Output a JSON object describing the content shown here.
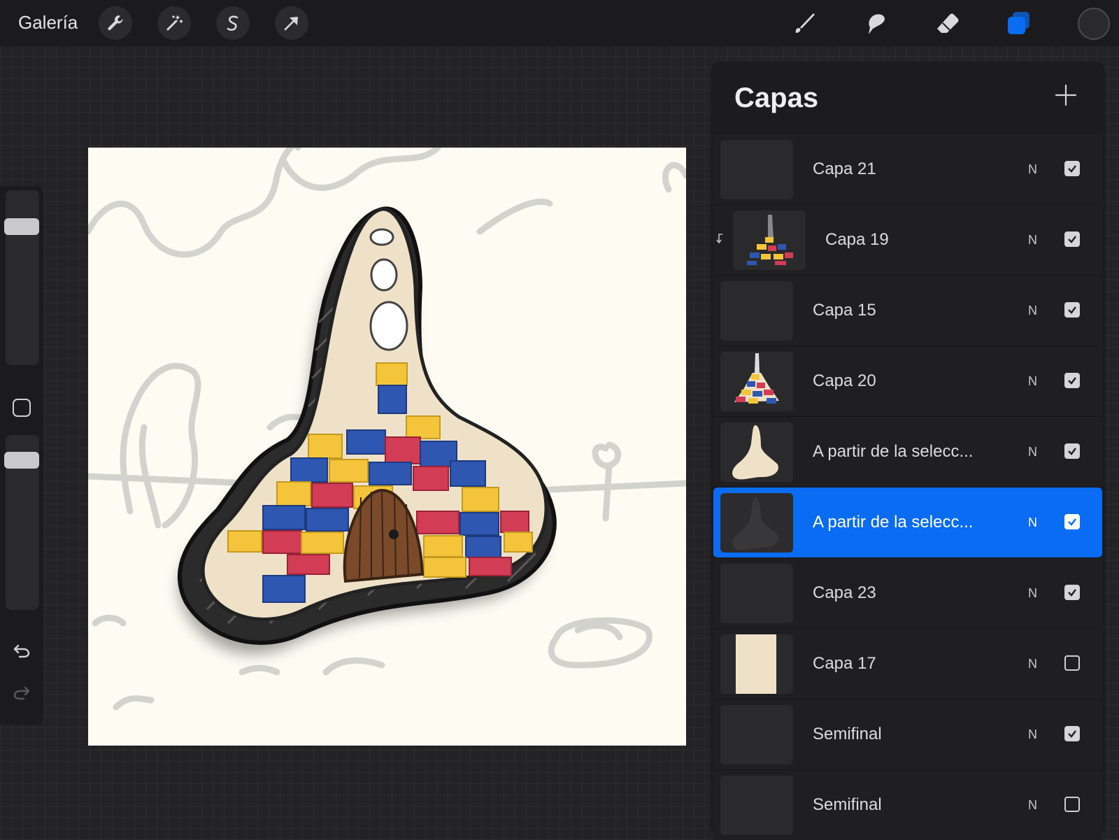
{
  "toolbar": {
    "gallery_label": "Galería",
    "left_tools": [
      {
        "name": "actions",
        "icon": "wrench-icon"
      },
      {
        "name": "adjustments",
        "icon": "magic-wand-icon"
      },
      {
        "name": "selection",
        "icon": "selection-s-icon"
      },
      {
        "name": "transform",
        "icon": "arrow-cursor-icon"
      }
    ],
    "right_tools": [
      {
        "name": "brush",
        "icon": "brush-icon"
      },
      {
        "name": "smudge",
        "icon": "smudge-icon"
      },
      {
        "name": "eraser",
        "icon": "eraser-icon"
      },
      {
        "name": "layers",
        "icon": "layers-icon",
        "active": true
      }
    ],
    "current_color": "#2a2a2c",
    "accent_color": "#0a6cf2"
  },
  "sidebar": {
    "size_icon": "size-slider",
    "opacity_icon": "opacity-slider",
    "modifier_icon": "square-modifier-icon",
    "undo_icon": "undo-icon",
    "redo_icon": "redo-icon"
  },
  "layers_panel": {
    "title": "Capas",
    "add_icon": "plus-icon",
    "layers": [
      {
        "name": "Capa 21",
        "blend": "N",
        "visible": true,
        "selected": false,
        "clipped": false,
        "thumb": "dark"
      },
      {
        "name": "Capa 19",
        "blend": "N",
        "visible": true,
        "selected": false,
        "clipped": true,
        "thumb": "blocks-color"
      },
      {
        "name": "Capa 15",
        "blend": "N",
        "visible": true,
        "selected": false,
        "clipped": false,
        "thumb": "dark"
      },
      {
        "name": "Capa 20",
        "blend": "N",
        "visible": true,
        "selected": false,
        "clipped": false,
        "thumb": "blocks-mountain"
      },
      {
        "name": "A partir de la selecc...",
        "blend": "N",
        "visible": true,
        "selected": false,
        "clipped": false,
        "thumb": "beige-shape"
      },
      {
        "name": "A partir de la selecc...",
        "blend": "N",
        "visible": true,
        "selected": true,
        "clipped": false,
        "thumb": "dark-shape"
      },
      {
        "name": "Capa 23",
        "blend": "N",
        "visible": true,
        "selected": false,
        "clipped": false,
        "thumb": "dark"
      },
      {
        "name": "Capa 17",
        "blend": "N",
        "visible": false,
        "selected": false,
        "clipped": false,
        "thumb": "beige-rect"
      },
      {
        "name": "Semifinal",
        "blend": "N",
        "visible": true,
        "selected": false,
        "clipped": false,
        "thumb": "dark"
      },
      {
        "name": "Semifinal",
        "blend": "N",
        "visible": false,
        "selected": false,
        "clipped": false,
        "thumb": "dark"
      }
    ]
  }
}
